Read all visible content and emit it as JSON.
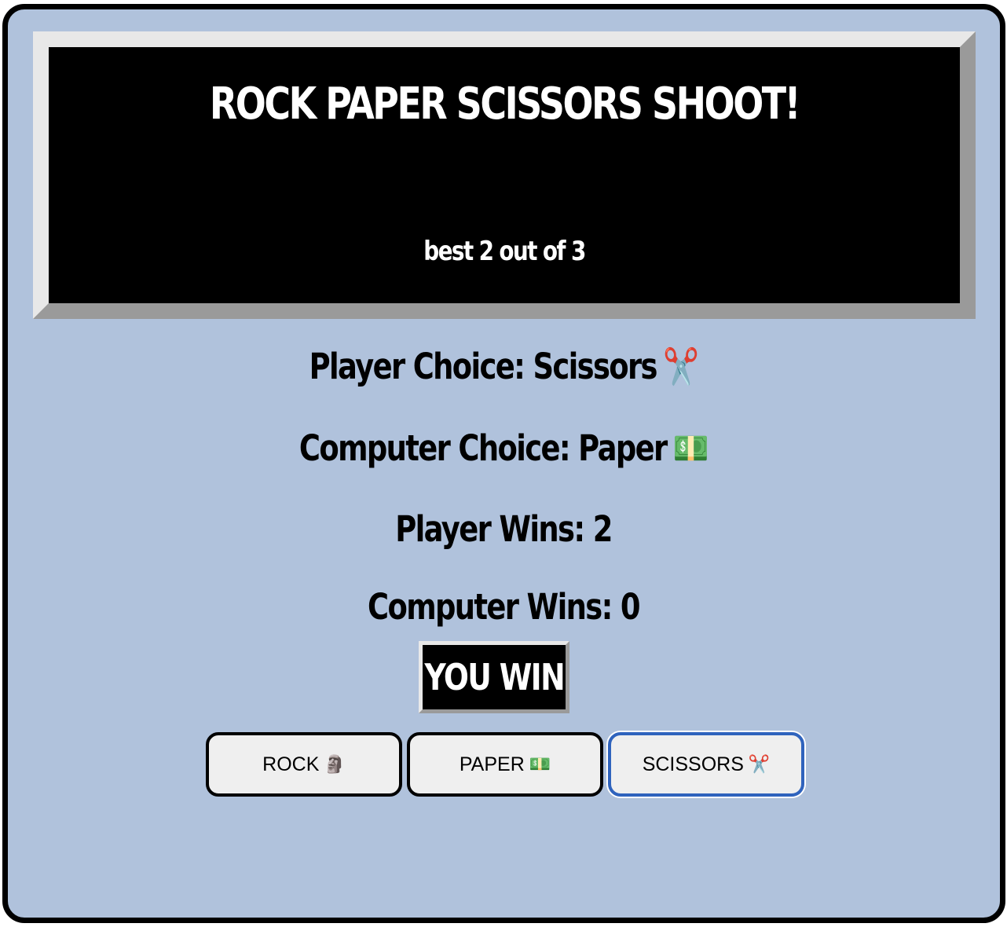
{
  "banner": {
    "title": "ROCK PAPER SCISSORS SHOOT!",
    "subtitle": "best 2 out of 3"
  },
  "stats": {
    "player_choice_label": "Player Choice: Scissors",
    "player_choice_icon": "✂️",
    "computer_choice_label": "Computer Choice: Paper",
    "computer_choice_icon": "💵",
    "player_wins": "Player Wins: 2",
    "computer_wins": "Computer Wins: 0"
  },
  "result": {
    "text": "YOU WIN"
  },
  "buttons": [
    {
      "label": "ROCK",
      "icon": "🗿",
      "icon_name": "moai-icon"
    },
    {
      "label": "PAPER",
      "icon": "💵",
      "icon_name": "dollar-bill-icon"
    },
    {
      "label": "SCISSORS",
      "icon": "✂️",
      "icon_name": "scissors-icon"
    }
  ],
  "colors": {
    "background": "#b0c2dc",
    "banner": "#000000",
    "focus_ring": "#2f63bd",
    "button_bg": "#efefef"
  }
}
